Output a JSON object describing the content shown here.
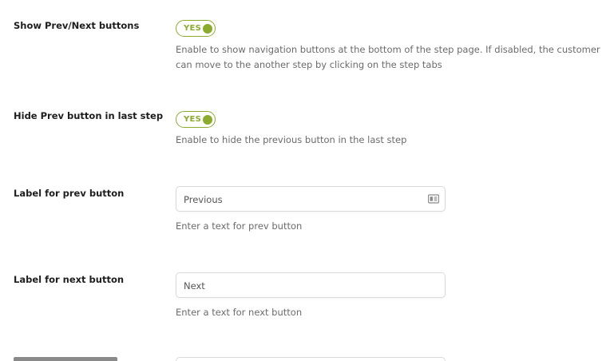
{
  "settings": {
    "show_prev_next": {
      "label": "Show Prev/Next buttons",
      "toggle_text": "YES",
      "help": "Enable to show navigation buttons at the bottom of the step page. If disabled, the customer can move to the another step by clicking on the step tabs"
    },
    "hide_prev_last": {
      "label": "Hide Prev button in last step",
      "toggle_text": "YES",
      "help": "Enable to hide the previous button in the last step"
    },
    "prev_label": {
      "label": "Label for prev button",
      "value": "Previous",
      "icon": "contact-card-icon",
      "help": "Enter a text for prev button"
    },
    "next_label": {
      "label": "Label for next button",
      "value": "Next",
      "help": "Enter a text for next button"
    }
  },
  "colors": {
    "accent": "#8bab2f",
    "label_text": "#1e1e1e",
    "help_text": "#6b6b6b",
    "input_border": "#d9d9d9"
  }
}
